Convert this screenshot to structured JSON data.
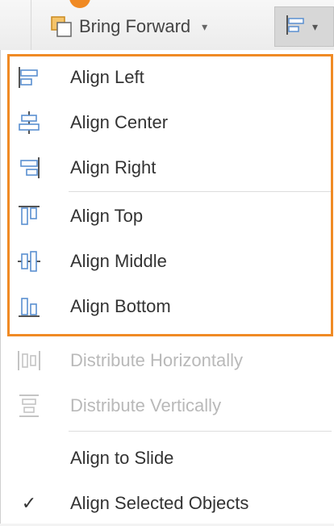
{
  "ribbon": {
    "bring_forward_label": "Bring Forward",
    "dropdown_caret": "▾"
  },
  "menu": {
    "items": [
      {
        "label": "Align Left",
        "icon": "align-left-icon",
        "enabled": true
      },
      {
        "label": "Align Center",
        "icon": "align-center-icon",
        "enabled": true
      },
      {
        "label": "Align Right",
        "icon": "align-right-icon",
        "enabled": true
      },
      {
        "label": "Align Top",
        "icon": "align-top-icon",
        "enabled": true
      },
      {
        "label": "Align Middle",
        "icon": "align-middle-icon",
        "enabled": true
      },
      {
        "label": "Align Bottom",
        "icon": "align-bottom-icon",
        "enabled": true
      },
      {
        "label": "Distribute Horizontally",
        "icon": "distribute-horizontally-icon",
        "enabled": false
      },
      {
        "label": "Distribute Vertically",
        "icon": "distribute-vertically-icon",
        "enabled": false
      },
      {
        "label": "Align to Slide",
        "icon": "",
        "enabled": true
      },
      {
        "label": "Align Selected Objects",
        "icon": "checkmark-icon",
        "enabled": true,
        "checked": true
      }
    ]
  },
  "colors": {
    "highlight": "#f08a24",
    "icon_blue": "#5a8fd0",
    "icon_dark": "#555555",
    "disabled_text": "#b9b9b9"
  }
}
